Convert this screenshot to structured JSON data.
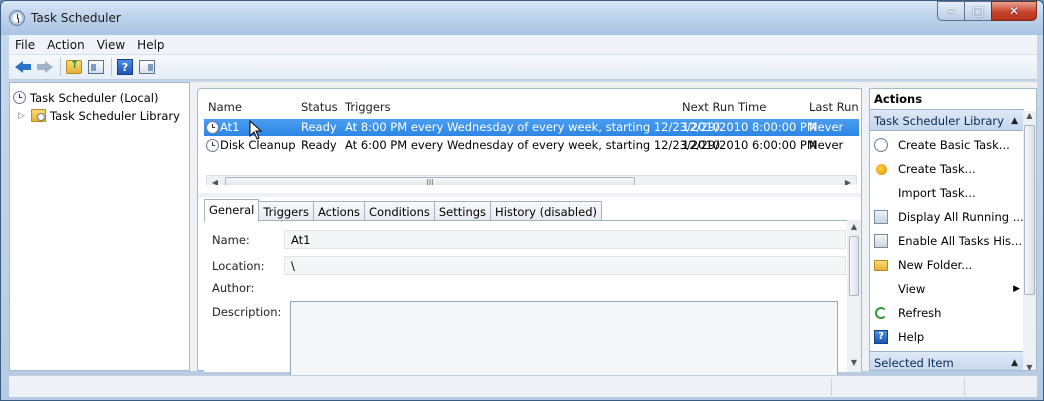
{
  "window": {
    "title": "Task Scheduler"
  },
  "menu": {
    "items": [
      "File",
      "Action",
      "View",
      "Help"
    ]
  },
  "toolbar": {
    "help_glyph": "?"
  },
  "tree": {
    "root": "Task Scheduler (Local)",
    "child": "Task Scheduler Library"
  },
  "tasks": {
    "columns": [
      "Name",
      "Status",
      "Triggers",
      "Next Run Time",
      "Last Run Time"
    ],
    "rows": [
      {
        "name": "At1",
        "status": "Ready",
        "triggers": "At 8:00 PM every Wednesday of every week, starting 12/23/2010",
        "next_run": "12/29/2010 8:00:00 PM",
        "last_run": "Never",
        "selected": true
      },
      {
        "name": "Disk Cleanup",
        "status": "Ready",
        "triggers": "At 6:00 PM every Wednesday of every week, starting 12/23/2010",
        "next_run": "12/29/2010 6:00:00 PM",
        "last_run": "Never",
        "selected": false
      }
    ],
    "scroll_thumb_glyph": "III"
  },
  "tabs": [
    "General",
    "Triggers",
    "Actions",
    "Conditions",
    "Settings",
    "History (disabled)"
  ],
  "general": {
    "name_label": "Name:",
    "name_value": "At1",
    "location_label": "Location:",
    "location_value": "\\",
    "author_label": "Author:",
    "description_label": "Description:"
  },
  "actions": {
    "title": "Actions",
    "section_library": "Task Scheduler Library",
    "items": [
      "Create Basic Task...",
      "Create Task...",
      "Import Task...",
      "Display All Running ...",
      "Enable All Tasks His...",
      "New Folder...",
      "View",
      "Refresh",
      "Help"
    ],
    "section_selected": "Selected Item"
  },
  "colors": {
    "selection": "#3391e8",
    "close_button": "#c7442b",
    "section_header": "#c3d6ee"
  }
}
